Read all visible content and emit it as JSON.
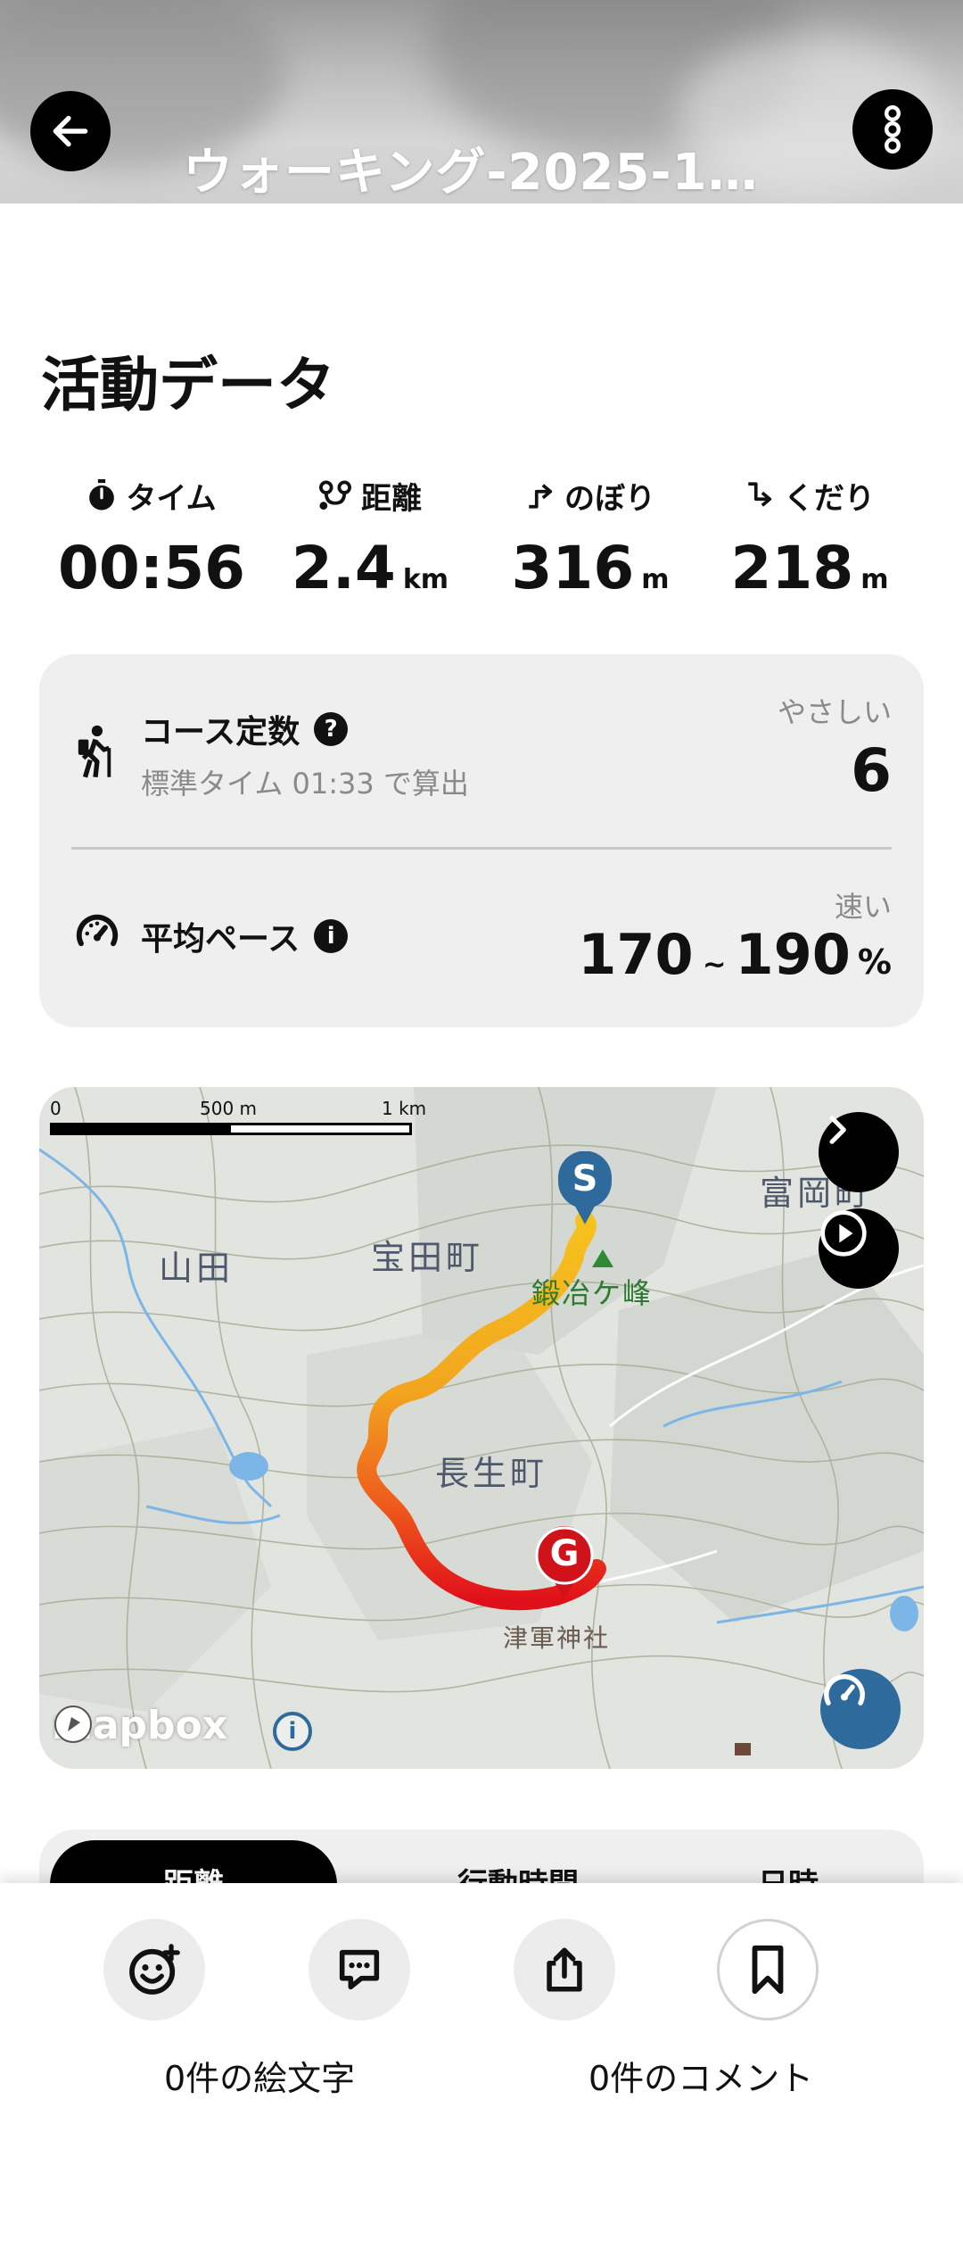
{
  "header": {
    "title": "ウォーキング-2025-1…"
  },
  "section": {
    "title": "活動データ"
  },
  "stats": [
    {
      "label": "タイム",
      "value": "00:56",
      "unit": "",
      "icon": "stopwatch-icon"
    },
    {
      "label": "距離",
      "value": "2.4",
      "unit": "km",
      "icon": "route-icon"
    },
    {
      "label": "のぼり",
      "value": "316",
      "unit": "m",
      "icon": "ascent-icon"
    },
    {
      "label": "くだり",
      "value": "218",
      "unit": "m",
      "icon": "descent-icon"
    }
  ],
  "course": {
    "title": "コース定数",
    "help": "?",
    "subtitle": "標準タイム 01:33 で算出",
    "rank": "やさしい",
    "value": "6"
  },
  "pace": {
    "title": "平均ペース",
    "info": "i",
    "rank": "速い",
    "min": "170",
    "tilde": "~",
    "max": "190",
    "unit": "%"
  },
  "map": {
    "scale_labels": [
      "0",
      "500 m",
      "1 km"
    ],
    "place_names": [
      "山田",
      "宝田町",
      "富岡町",
      "長生町"
    ],
    "poi_labels": [
      "鍛冶ケ峰",
      "津軍神社"
    ],
    "start_marker": "S",
    "goal_marker": "G",
    "attribution": "mapbox",
    "info": "i"
  },
  "tabs": [
    {
      "label": "距離",
      "active": true
    },
    {
      "label": "行動時間",
      "active": false
    },
    {
      "label": "日時",
      "active": false
    }
  ],
  "bottom": {
    "emoji_count": "0件の絵文字",
    "comment_count": "0件のコメント"
  },
  "colors": {
    "accent_blue": "#2f6a9c",
    "goal_red": "#d0121b",
    "track_start": "#f6c21e",
    "track_end": "#e0101a"
  }
}
